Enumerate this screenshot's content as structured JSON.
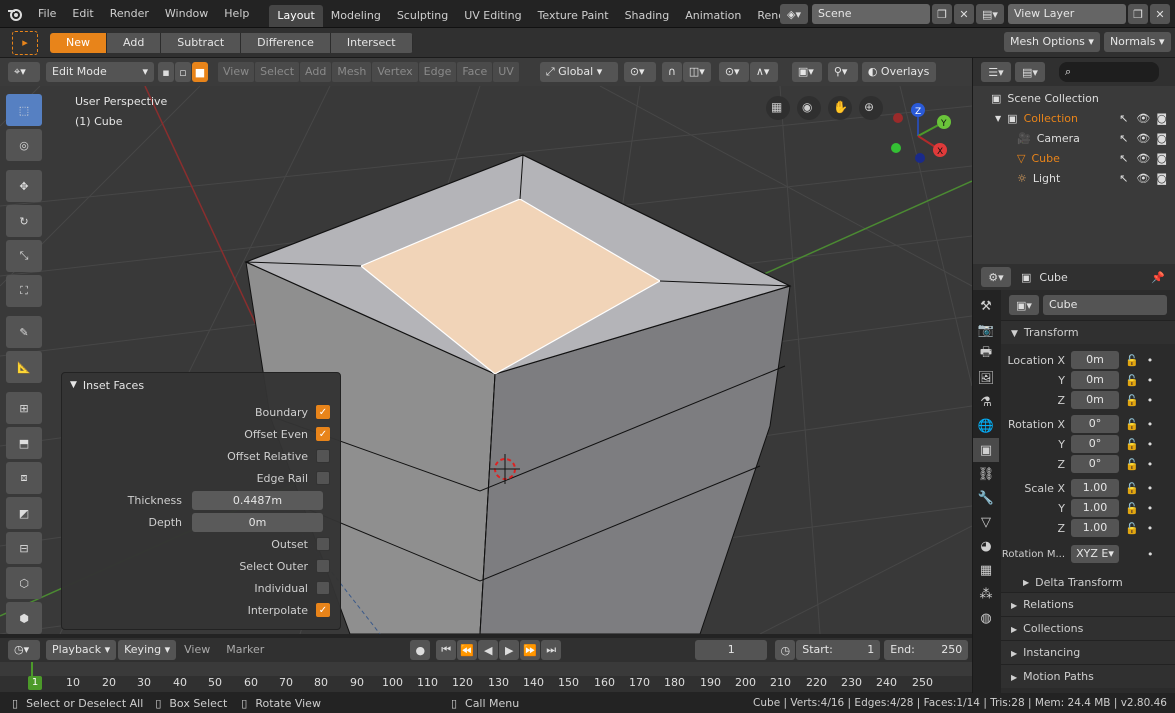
{
  "topbar": {
    "menus": [
      "File",
      "Edit",
      "Render",
      "Window",
      "Help"
    ],
    "workspaces": [
      "Layout",
      "Modeling",
      "Sculpting",
      "UV Editing",
      "Texture Paint",
      "Shading",
      "Animation",
      "Rende"
    ],
    "scene": "Scene",
    "view_layer": "View Layer"
  },
  "tool_header": {
    "modes": [
      "New",
      "Add",
      "Subtract",
      "Difference",
      "Intersect"
    ],
    "mesh_options": "Mesh Options",
    "normals": "Normals"
  },
  "viewport_header": {
    "mode": "Edit Mode",
    "menus": [
      "View",
      "Select",
      "Add",
      "Mesh",
      "Vertex",
      "Edge",
      "Face",
      "UV"
    ],
    "orientation": "Global",
    "overlays": "Overlays"
  },
  "viewport": {
    "perspective": "User Perspective",
    "object": "(1) Cube",
    "gizmo_labels": [
      "Z",
      "Y",
      "X"
    ]
  },
  "inset_faces": {
    "title": "Inset Faces",
    "options_top": [
      {
        "label": "Boundary",
        "checked": true
      },
      {
        "label": "Offset Even",
        "checked": true
      },
      {
        "label": "Offset Relative",
        "checked": false
      },
      {
        "label": "Edge Rail",
        "checked": false
      }
    ],
    "thickness_label": "Thickness",
    "thickness": "0.4487m",
    "depth_label": "Depth",
    "depth": "0m",
    "options_bottom": [
      {
        "label": "Outset",
        "checked": false
      },
      {
        "label": "Select Outer",
        "checked": false
      },
      {
        "label": "Individual",
        "checked": false
      },
      {
        "label": "Interpolate",
        "checked": true
      }
    ]
  },
  "outliner": {
    "root": "Scene Collection",
    "collection": "Collection",
    "items": [
      "Camera",
      "Cube",
      "Light"
    ]
  },
  "properties": {
    "context_name": "Cube",
    "object_name": "Cube",
    "transform_title": "Transform",
    "location_label": "Location X",
    "location": [
      "0m",
      "0m",
      "0m"
    ],
    "rotation_label": "Rotation X",
    "rotation": [
      "0°",
      "0°",
      "0°"
    ],
    "scale_label": "Scale X",
    "scale": [
      "1.00",
      "1.00",
      "1.00"
    ],
    "axis_y": "Y",
    "axis_z": "Z",
    "rotation_mode_label": "Rotation M...",
    "rotation_mode": "XYZ E",
    "delta_transform": "Delta Transform",
    "panels": [
      "Relations",
      "Collections",
      "Instancing",
      "Motion Paths"
    ]
  },
  "timeline": {
    "menus": [
      "Playback",
      "Keying",
      "View",
      "Marker"
    ],
    "current_frame": "1",
    "start_label": "Start:",
    "start": "1",
    "end_label": "End:",
    "end": "250",
    "ticks": [
      "1",
      "10",
      "20",
      "30",
      "40",
      "50",
      "60",
      "70",
      "80",
      "90",
      "100",
      "110",
      "120",
      "130",
      "140",
      "150",
      "160",
      "170",
      "180",
      "190",
      "200",
      "210",
      "220",
      "230",
      "240",
      "250"
    ]
  },
  "statusbar": {
    "select": "Select or Deselect All",
    "box_select": "Box Select",
    "rotate_view": "Rotate View",
    "call_menu": "Call Menu",
    "stats": "Cube | Verts:4/16 | Edges:4/28 | Faces:1/14 | Tris:28 | Mem: 24.4 MB | v2.80.46"
  },
  "colors": {
    "accent": "#e8841a",
    "active_tool": "#5680c2",
    "selected_face": "#f1d4b8",
    "grid": "#474747"
  }
}
